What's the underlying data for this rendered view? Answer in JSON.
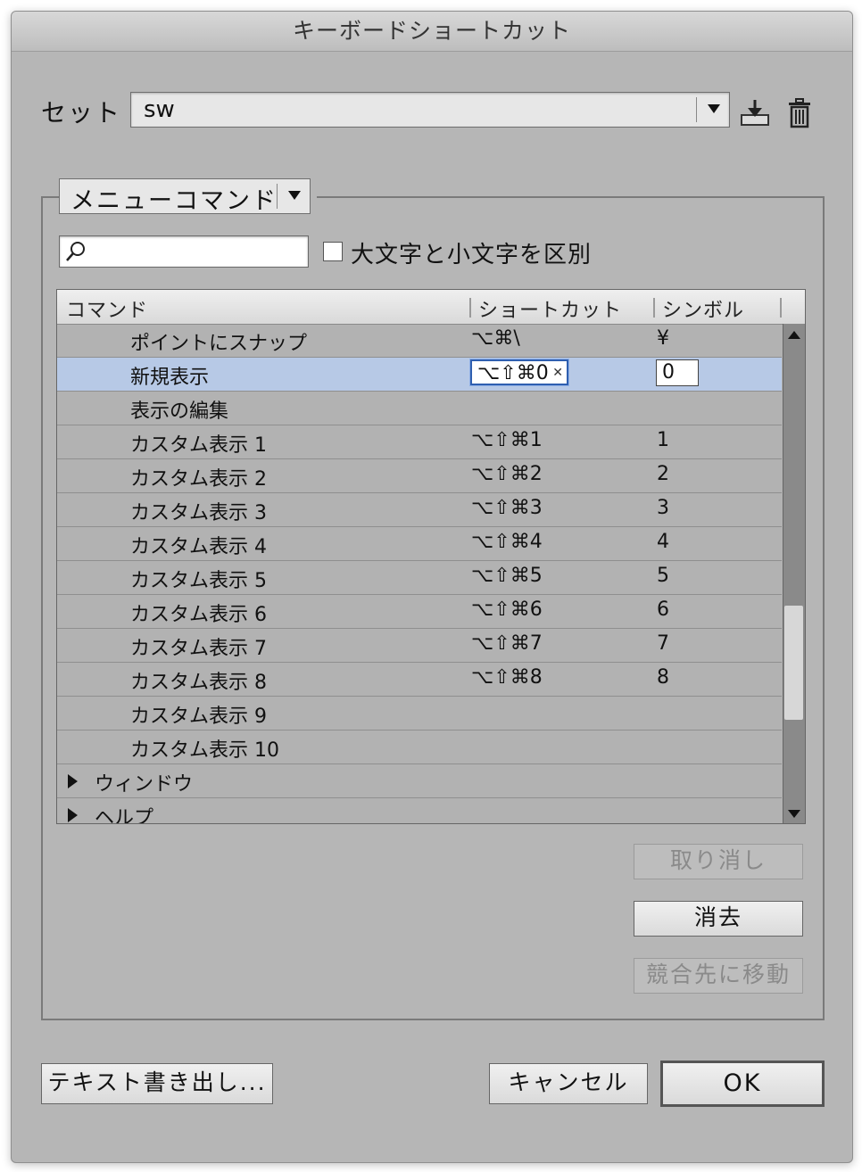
{
  "window": {
    "title": "キーボードショートカット"
  },
  "set": {
    "label": "セット :",
    "value": "sw",
    "save_icon": "save-set-icon",
    "delete_icon": "trash-icon"
  },
  "filter": {
    "category": "メニューコマンド",
    "search_value": "",
    "search_icon": "magnifier-icon",
    "case_label": "大文字と小文字を区別",
    "case_checked": false
  },
  "table": {
    "headers": {
      "command": "コマンド",
      "shortcut": "ショートカット",
      "symbol": "シンボル"
    },
    "rows": [
      {
        "command": "ポイントにスナップ",
        "shortcut": "⌥⌘\\",
        "symbol": "¥"
      },
      {
        "command": "新規表示",
        "shortcut": "⌥⇧⌘0",
        "symbol": "0"
      },
      {
        "command": "表示の編集",
        "shortcut": "",
        "symbol": ""
      },
      {
        "command": "カスタム表示 1",
        "shortcut": "⌥⇧⌘1",
        "symbol": "1"
      },
      {
        "command": "カスタム表示 2",
        "shortcut": "⌥⇧⌘2",
        "symbol": "2"
      },
      {
        "command": "カスタム表示 3",
        "shortcut": "⌥⇧⌘3",
        "symbol": "3"
      },
      {
        "command": "カスタム表示 4",
        "shortcut": "⌥⇧⌘4",
        "symbol": "4"
      },
      {
        "command": "カスタム表示 5",
        "shortcut": "⌥⇧⌘5",
        "symbol": "5"
      },
      {
        "command": "カスタム表示 6",
        "shortcut": "⌥⇧⌘6",
        "symbol": "6"
      },
      {
        "command": "カスタム表示 7",
        "shortcut": "⌥⇧⌘7",
        "symbol": "7"
      },
      {
        "command": "カスタム表示 8",
        "shortcut": "⌥⇧⌘8",
        "symbol": "8"
      },
      {
        "command": "カスタム表示 9",
        "shortcut": "",
        "symbol": ""
      },
      {
        "command": "カスタム表示 10",
        "shortcut": "",
        "symbol": ""
      },
      {
        "command": "ウィンドウ",
        "shortcut": "",
        "symbol": ""
      },
      {
        "command": "ヘルプ",
        "shortcut": "",
        "symbol": ""
      }
    ]
  },
  "actions": {
    "undo": "取り消し",
    "clear": "消去",
    "goto_conflict": "競合先に移動"
  },
  "footer": {
    "export": "テキスト書き出し...",
    "cancel": "キャンセル",
    "ok": "OK"
  }
}
